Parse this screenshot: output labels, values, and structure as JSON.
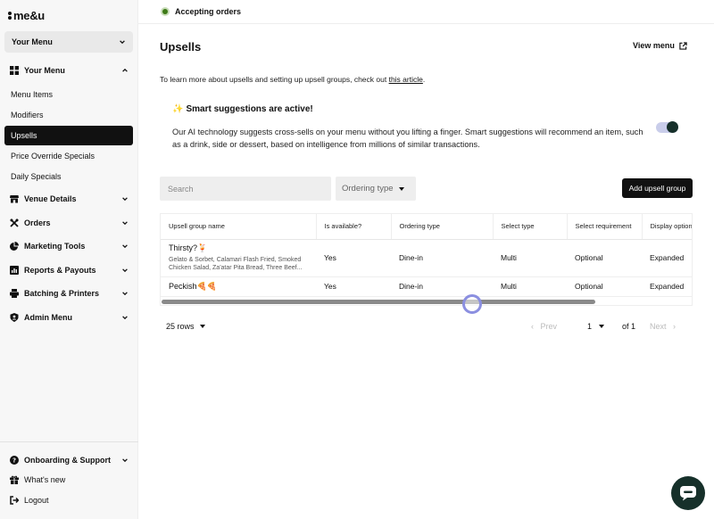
{
  "brand": {
    "logo_text": "me&u"
  },
  "sidebar": {
    "menu_select": "Your Menu",
    "groups": [
      {
        "label": "Your Menu",
        "icon": "grid-icon"
      },
      {
        "label": "Venue Details",
        "icon": "store-icon"
      },
      {
        "label": "Orders",
        "icon": "utensils-icon"
      },
      {
        "label": "Marketing Tools",
        "icon": "pie-chart-icon"
      },
      {
        "label": "Reports & Payouts",
        "icon": "bar-chart-icon"
      },
      {
        "label": "Batching & Printers",
        "icon": "printer-icon"
      },
      {
        "label": "Admin Menu",
        "icon": "user-shield-icon"
      }
    ],
    "sub_items": [
      "Menu Items",
      "Modifiers",
      "Upsells",
      "Price Override Specials",
      "Daily Specials"
    ],
    "active_sub": "Upsells",
    "bottom": {
      "onboarding": "Onboarding & Support",
      "whats_new": "What's new",
      "logout": "Logout"
    }
  },
  "topbar": {
    "status": "Accepting orders"
  },
  "main": {
    "title": "Upsells",
    "view_menu": "View menu",
    "intro_text": "To learn more about upsells and setting up upsell groups, check out ",
    "intro_link": "this article",
    "intro_end": ".",
    "smart": {
      "emoji": "✨",
      "title": "Smart suggestions are active!",
      "description": "Our AI technology suggests cross-sells on your menu without you lifting a finger. Smart suggestions will recommend an item, such as a drink, side or dessert, based on intelligence from millions of similar transactions.",
      "enabled": true
    },
    "search_placeholder": "Search",
    "ordering_type": "Ordering type",
    "add_button": "Add upsell group"
  },
  "table": {
    "columns": [
      "Upsell group name",
      "Is available?",
      "Ordering type",
      "Select type",
      "Select requirement",
      "Display option"
    ],
    "rows": [
      {
        "name": "Thirsty?🍹",
        "items": "Gelato & Sorbet, Calamari Flash Fried, Smoked Chicken Salad, Za'atar Pita Bread, Three Beef...",
        "available": "Yes",
        "ordering": "Dine-in",
        "select_type": "Multi",
        "requirement": "Optional",
        "display": "Expanded"
      },
      {
        "name": "Peckish🍕🍕",
        "items": "",
        "available": "Yes",
        "ordering": "Dine-in",
        "select_type": "Multi",
        "requirement": "Optional",
        "display": "Expanded"
      }
    ],
    "scroll_fraction": 0.82
  },
  "pagination": {
    "rows_per_page": "25 rows",
    "prev": "Prev",
    "page": "1",
    "of": "of 1",
    "next": "Next"
  },
  "colors": {
    "accent_dark": "#16302a",
    "status_green": "#3d7a17",
    "toggle_track": "#c9cdea"
  }
}
